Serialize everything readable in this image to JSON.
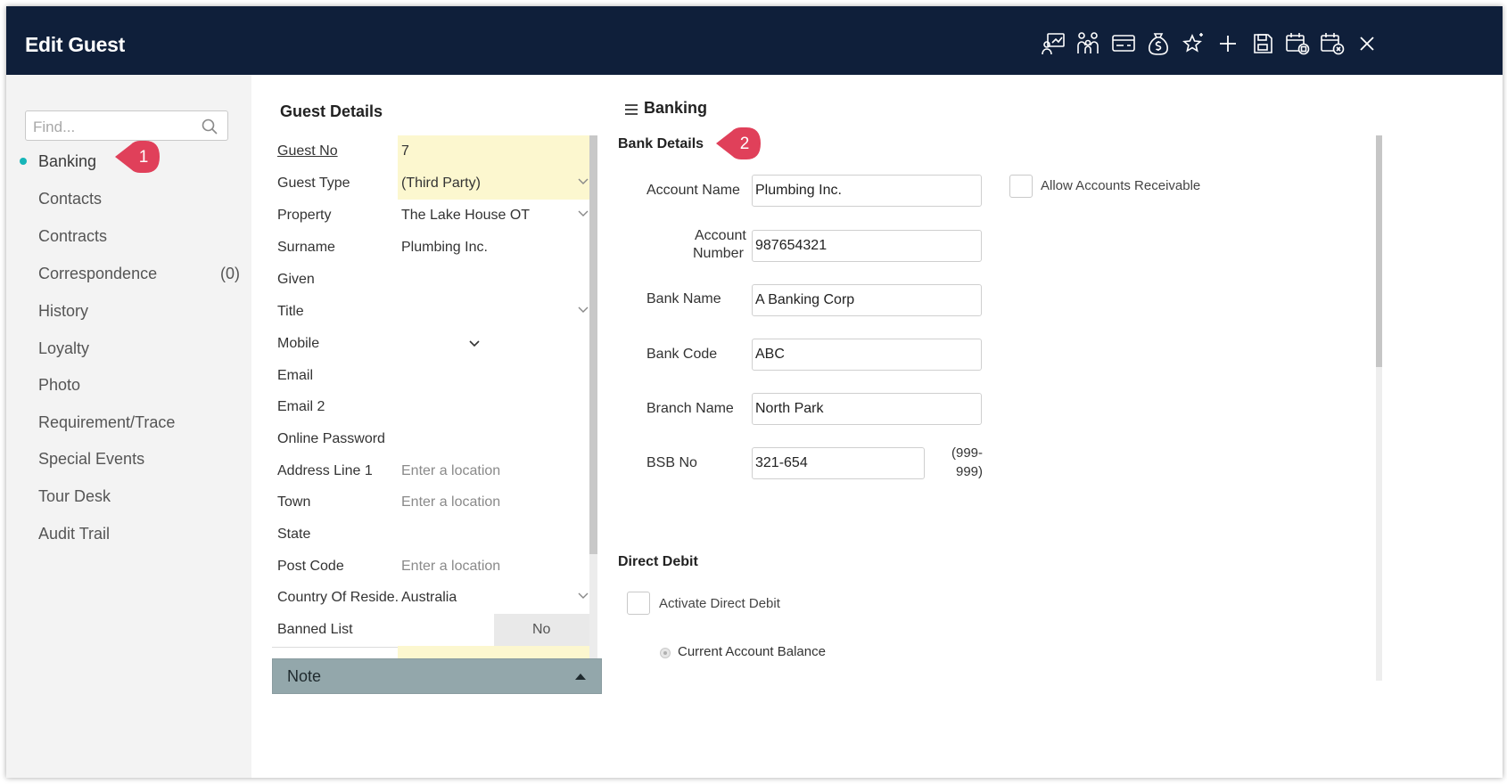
{
  "window": {
    "title": "Edit Guest"
  },
  "toolbar": {
    "icons": [
      "presentation-icon",
      "people-icon",
      "card-icon",
      "money-bag-icon",
      "sparkle-star-icon",
      "plus-icon",
      "save-icon",
      "calendar-save-icon",
      "calendar-cancel-icon",
      "close-icon"
    ]
  },
  "sidebar": {
    "search_placeholder": "Find...",
    "items": [
      {
        "label": "Banking"
      },
      {
        "label": "Contacts"
      },
      {
        "label": "Contracts"
      },
      {
        "label": "Correspondence",
        "count": "(0)"
      },
      {
        "label": "History"
      },
      {
        "label": "Loyalty"
      },
      {
        "label": "Photo"
      },
      {
        "label": "Requirement/Trace"
      },
      {
        "label": "Special Events"
      },
      {
        "label": "Tour Desk"
      },
      {
        "label": "Audit Trail"
      }
    ]
  },
  "callouts": {
    "one": "1",
    "two": "2",
    "color": "#e0405a"
  },
  "guest_details": {
    "title": "Guest Details",
    "rows": [
      {
        "label": "Guest No",
        "value": "7"
      },
      {
        "label": "Guest Type",
        "value": "(Third Party)"
      },
      {
        "label": "Property",
        "value": "The Lake House OT"
      },
      {
        "label": "Surname",
        "value": "Plumbing Inc."
      },
      {
        "label": "Given",
        "value": ""
      },
      {
        "label": "Title",
        "value": ""
      },
      {
        "label": "Mobile",
        "value": ""
      },
      {
        "label": "Email",
        "value": ""
      },
      {
        "label": "Email 2",
        "value": ""
      },
      {
        "label": "Online Password",
        "value": ""
      },
      {
        "label": "Address Line 1",
        "placeholder": "Enter a location"
      },
      {
        "label": "Town",
        "placeholder": "Enter a location"
      },
      {
        "label": "State",
        "value": ""
      },
      {
        "label": "Post Code",
        "placeholder": "Enter a location"
      },
      {
        "label": "Country Of Reside...",
        "value": "Australia"
      },
      {
        "label": "Banned List",
        "value": "No"
      }
    ],
    "note_label": "Note"
  },
  "banking": {
    "title": "Banking",
    "bank_details_title": "Bank Details",
    "account_name_label": "Account Name",
    "account_name": "Plumbing Inc.",
    "account_number_label_1": "Account",
    "account_number_label_2": "Number",
    "account_number": "987654321",
    "bank_name_label": "Bank Name",
    "bank_name": "A Banking Corp",
    "bank_code_label": "Bank Code",
    "bank_code": "ABC",
    "branch_name_label": "Branch Name",
    "branch_name": "North Park",
    "bsb_label": "BSB No",
    "bsb": "321-654",
    "bsb_hint_1": "(999-",
    "bsb_hint_2": "999)",
    "allow_ar_label": "Allow Accounts Receivable",
    "direct_debit_title": "Direct Debit",
    "activate_dd_label": "Activate Direct Debit",
    "current_balance_label": "Current Account Balance"
  },
  "colors": {
    "titlebar": "#0f1f3a",
    "accent": "#16b5b8",
    "highlight": "#fcf7cf",
    "note_bar": "#93a7ab"
  }
}
